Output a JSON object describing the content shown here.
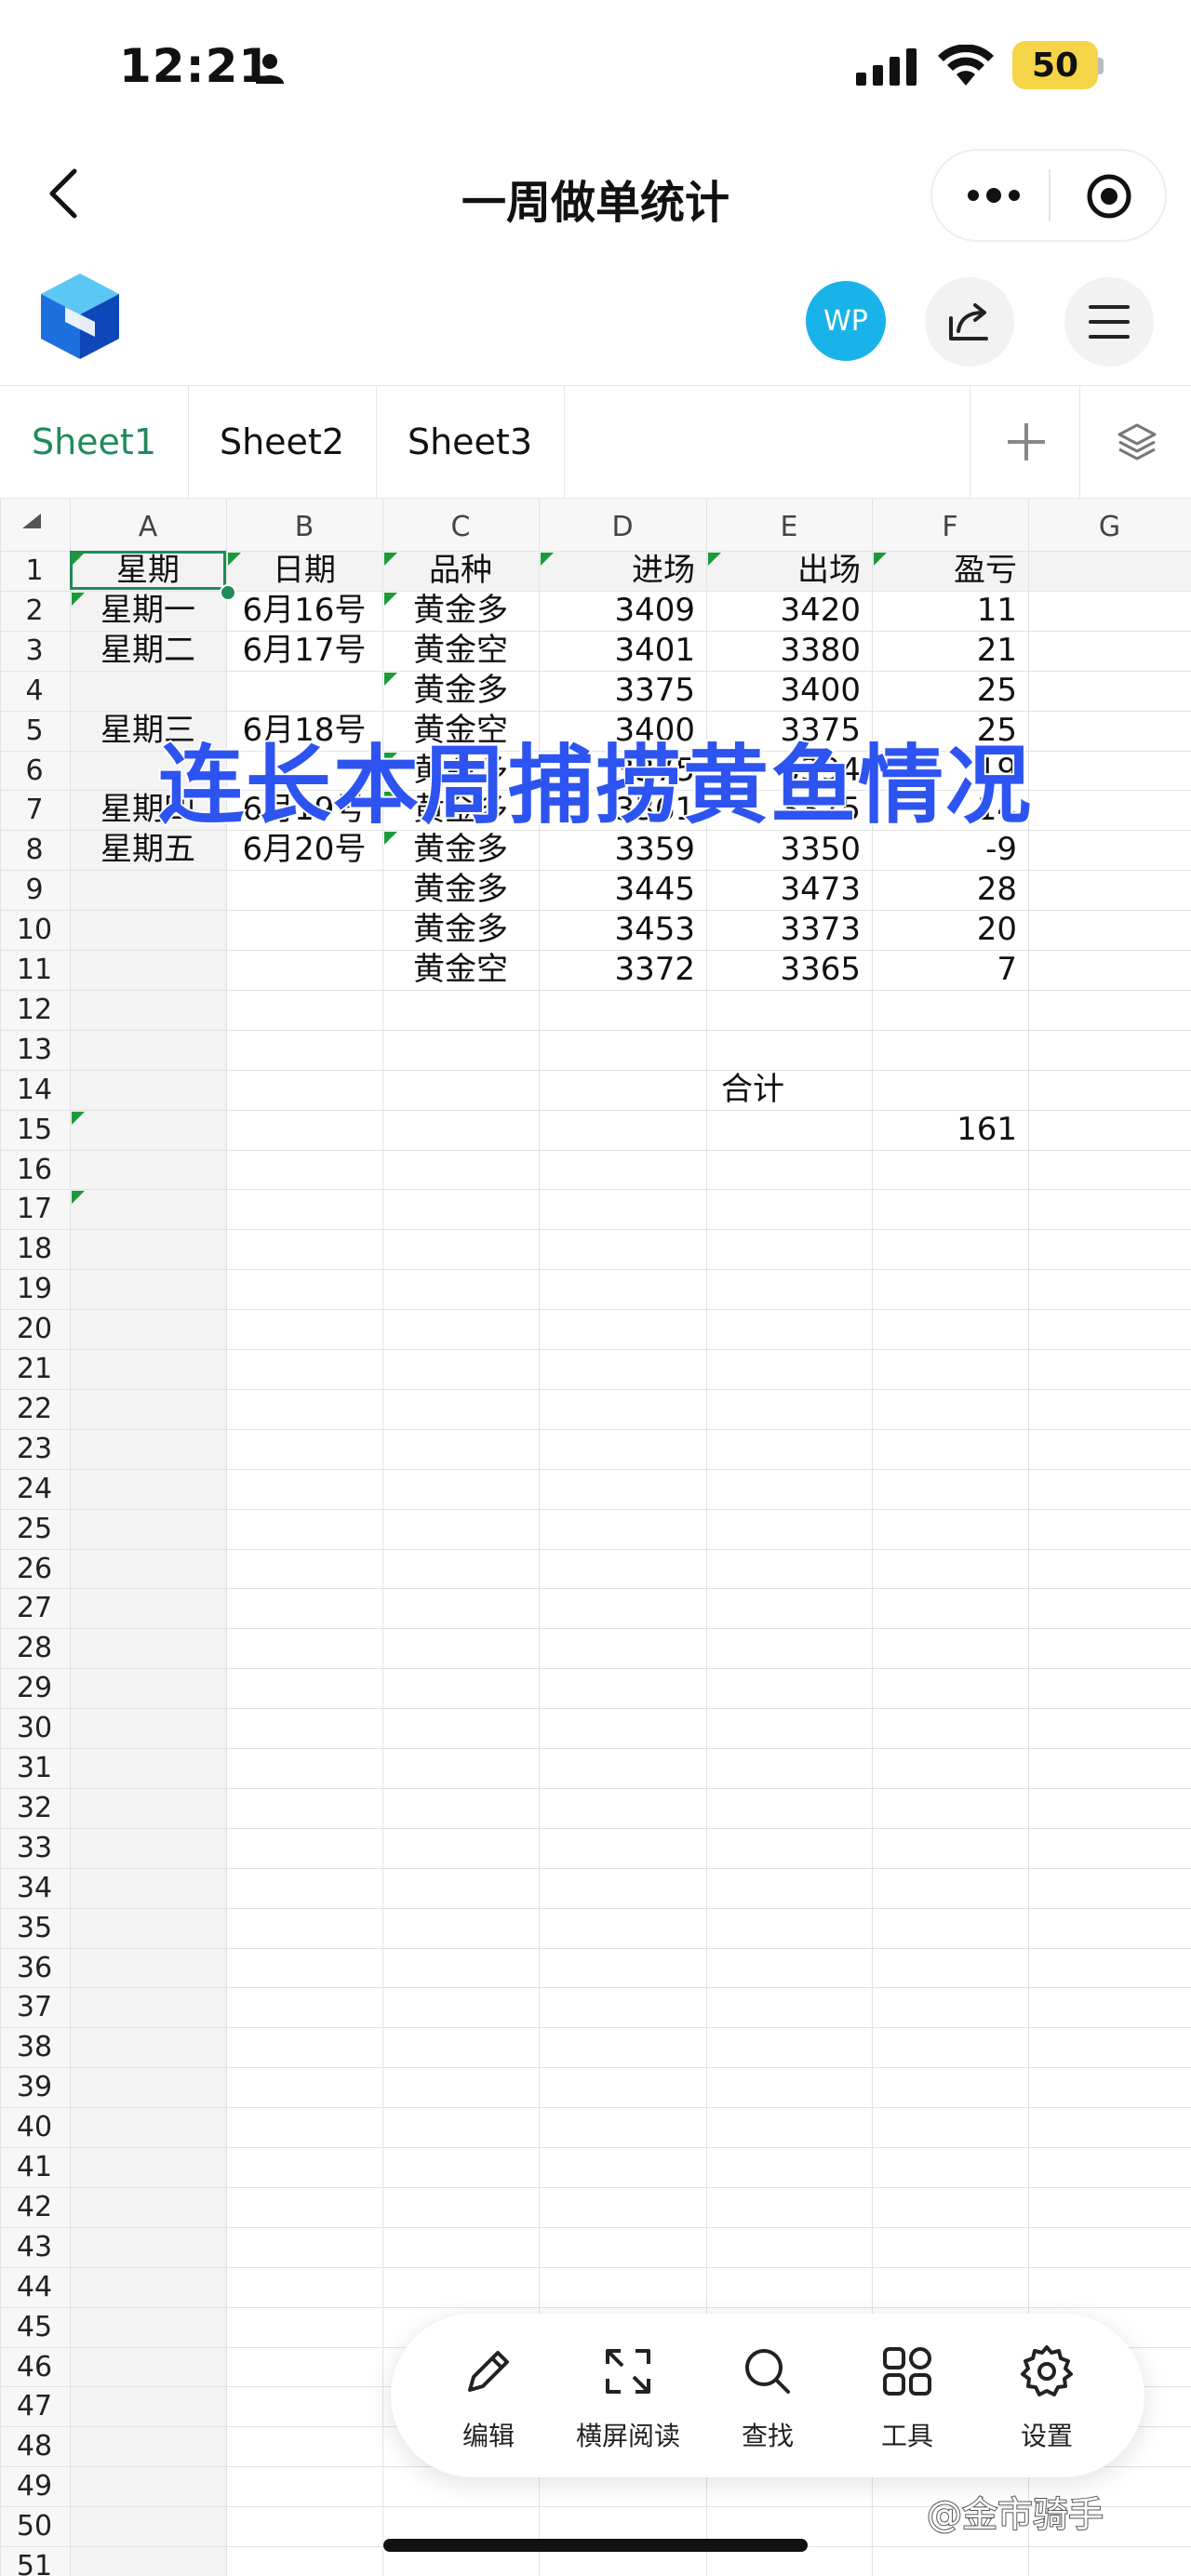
{
  "status_bar": {
    "time": "12:21",
    "battery": "50"
  },
  "nav": {
    "title": "一周做单统计"
  },
  "toolbar": {
    "avatar": "WP"
  },
  "tabs": [
    {
      "label": "Sheet1",
      "active": true
    },
    {
      "label": "Sheet2",
      "active": false
    },
    {
      "label": "Sheet3",
      "active": false
    }
  ],
  "columns": [
    "A",
    "B",
    "C",
    "D",
    "E",
    "F",
    "G"
  ],
  "rows": [
    "1",
    "2",
    "3",
    "4",
    "5",
    "6",
    "7",
    "8",
    "9",
    "10",
    "11",
    "12",
    "13",
    "14",
    "15",
    "16",
    "17",
    "18",
    "19",
    "20",
    "21",
    "22",
    "23",
    "24",
    "25",
    "26",
    "27",
    "28",
    "29",
    "30",
    "31",
    "32",
    "33",
    "34",
    "35",
    "36",
    "37",
    "38",
    "39",
    "40",
    "41",
    "42",
    "43",
    "44",
    "45",
    "46",
    "47",
    "48",
    "49",
    "50",
    "51"
  ],
  "headers": {
    "A": "星期",
    "B": "日期",
    "C": "品种",
    "D": "进场",
    "E": "出场",
    "F": "盈亏"
  },
  "table": [
    {
      "A": "星期一",
      "B": "6月16号",
      "C": "黄金多",
      "D": "3409",
      "E": "3420",
      "F": "11"
    },
    {
      "A": "星期二",
      "B": "6月17号",
      "C": "黄金空",
      "D": "3401",
      "E": "3380",
      "F": "21"
    },
    {
      "A": "",
      "B": "",
      "C": "黄金多",
      "D": "3375",
      "E": "3400",
      "F": "25"
    },
    {
      "A": "星期三",
      "B": "6月18号",
      "C": "黄金空",
      "D": "3400",
      "E": "3375",
      "F": "25"
    },
    {
      "A": "",
      "B": "",
      "C": "黄金多",
      "D": "3375",
      "E": "3394",
      "F": "19"
    },
    {
      "A": "星期四",
      "B": "6月19号",
      "C": "黄金多",
      "D": "3361",
      "E": "3375",
      "F": "14"
    },
    {
      "A": "星期五",
      "B": "6月20号",
      "C": "黄金多",
      "D": "3359",
      "E": "3350",
      "F": "-9"
    },
    {
      "A": "",
      "B": "",
      "C": "黄金多",
      "D": "3445",
      "E": "3473",
      "F": "28"
    },
    {
      "A": "",
      "B": "",
      "C": "黄金多",
      "D": "3453",
      "E": "3373",
      "F": "20"
    },
    {
      "A": "",
      "B": "",
      "C": "黄金空",
      "D": "3372",
      "E": "3365",
      "F": "7"
    }
  ],
  "summary": {
    "label": "合计",
    "total": "161"
  },
  "overlay_caption": "连长本周捕捞黄鱼情况",
  "bottom_toolbar": [
    {
      "label": "编辑",
      "icon": "pencil-icon"
    },
    {
      "label": "横屏阅读",
      "icon": "expand-icon"
    },
    {
      "label": "查找",
      "icon": "search-icon"
    },
    {
      "label": "工具",
      "icon": "apps-icon"
    },
    {
      "label": "设置",
      "icon": "gear-icon"
    }
  ],
  "watermark": "@金市骑手",
  "colors": {
    "accent": "#1f8a5a",
    "avatar": "#19b3ea",
    "caption": "#2d54f0"
  }
}
